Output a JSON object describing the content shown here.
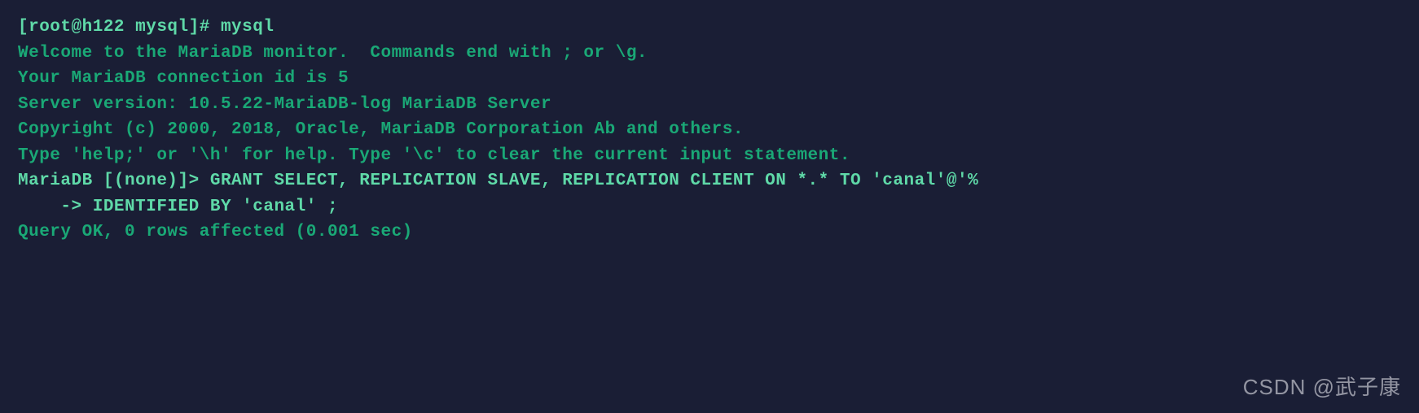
{
  "terminal": {
    "prompt_line": "[root@h122 mysql]# mysql",
    "welcome_line": "Welcome to the MariaDB monitor.  Commands end with ; or \\g.",
    "connection_line": "Your MariaDB connection id is 5",
    "server_version_line": "Server version: 10.5.22-MariaDB-log MariaDB Server",
    "blank1": "",
    "copyright_line": "Copyright (c) 2000, 2018, Oracle, MariaDB Corporation Ab and others.",
    "blank2": "",
    "help_line": "Type 'help;' or '\\h' for help. Type '\\c' to clear the current input statement.",
    "blank3": "",
    "sql_prompt_line": "MariaDB [(none)]> GRANT SELECT, REPLICATION SLAVE, REPLICATION CLIENT ON *.* TO 'canal'@'%",
    "sql_continuation_line": "    -> IDENTIFIED BY 'canal' ;",
    "query_result_line": "Query OK, 0 rows affected (0.001 sec)"
  },
  "watermark": "CSDN @武子康"
}
